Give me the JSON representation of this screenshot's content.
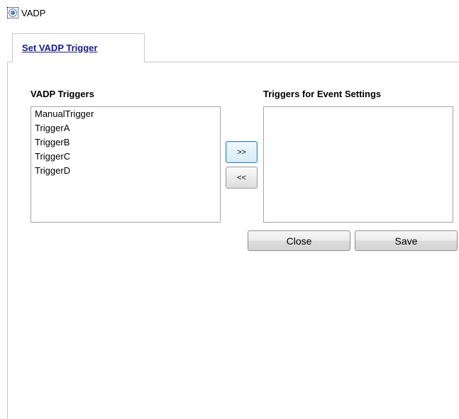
{
  "mode": {
    "label": "VADP",
    "selected": true
  },
  "tab": {
    "label": "Set VADP Trigger"
  },
  "available": {
    "title": "VADP Triggers",
    "items": [
      "ManualTrigger",
      "TriggerA",
      "TriggerB",
      "TriggerC",
      "TriggerD"
    ]
  },
  "selected_list": {
    "title": "Triggers for Event Settings",
    "items": []
  },
  "buttons": {
    "add": ">>",
    "remove": "<<",
    "close": "Close",
    "save": "Save"
  }
}
